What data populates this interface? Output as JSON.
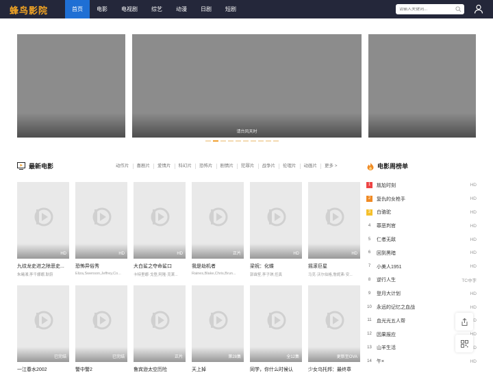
{
  "header": {
    "logo": "蜂鸟影院",
    "nav": [
      "首页",
      "电影",
      "电视剧",
      "综艺",
      "动漫",
      "日剧",
      "短剧"
    ],
    "search_placeholder": "请输入关键词..."
  },
  "banner": {
    "caption": "请台风天时"
  },
  "latest": {
    "title": "最新电影",
    "categories": [
      "动作片",
      "喜剧片",
      "爱情片",
      "科幻片",
      "恐怖片",
      "剧情片",
      "犯罪片",
      "战争片",
      "伦理片",
      "动画片",
      "更多 >"
    ]
  },
  "movies_row1": [
    {
      "title": "九纹龙史进之除恶史...",
      "sub": "朱曦湘,李千娜娜,耿蔚",
      "badge": "HD"
    },
    {
      "title": "恐怖异俗秀",
      "sub": "Eliza,Swenson,Jeffrey,Co...",
      "badge": "HD"
    },
    {
      "title": "大白鲨之夺命鲨口",
      "sub": "卡特里娜·戈登,阿隆·克莱...",
      "badge": "HD"
    },
    {
      "title": "我是劫机者",
      "sub": "Raines,Blake,Chris,Brun...",
      "badge": "正片"
    },
    {
      "title": "梁祝：化蝶",
      "sub": "郭霖笙,李子琪,任真",
      "badge": "HD"
    },
    {
      "title": "摇滚巨星",
      "sub": "马克·沃尔伯格,詹妮弗·安...",
      "badge": "HD"
    }
  ],
  "movies_row2": [
    {
      "title": "一江春水2002",
      "sub": "",
      "badge": "已完结"
    },
    {
      "title": "警中警2",
      "sub": "",
      "badge": "已完结"
    },
    {
      "title": "鲁宾逊太空历险",
      "sub": "",
      "badge": "正片"
    },
    {
      "title": "天上掉",
      "sub": "",
      "badge": "第28集"
    },
    {
      "title": "同学，你什么时候认",
      "sub": "",
      "badge": "全12集"
    },
    {
      "title": "少女乌托邦：最终章",
      "sub": "",
      "badge": "更新至OVA"
    }
  ],
  "ranking": {
    "title": "电影周榜单",
    "items": [
      {
        "n": "1",
        "name": "尴尬时刻",
        "tag": "HD"
      },
      {
        "n": "2",
        "name": "复仇的女枪手",
        "tag": "HD"
      },
      {
        "n": "3",
        "name": "白骆驼",
        "tag": "HD"
      },
      {
        "n": "4",
        "name": "罪恶判官",
        "tag": "HD"
      },
      {
        "n": "5",
        "name": "仁者无敌",
        "tag": "HD"
      },
      {
        "n": "6",
        "name": "回到黑暗",
        "tag": "HD"
      },
      {
        "n": "7",
        "name": "小美人1951",
        "tag": "HD"
      },
      {
        "n": "8",
        "name": "逆行人生",
        "tag": "TC中字"
      },
      {
        "n": "9",
        "name": "登月大计划",
        "tag": "HD"
      },
      {
        "n": "10",
        "name": "永远的记忆之血战",
        "tag": "HD"
      },
      {
        "n": "11",
        "name": "血光光五人帮",
        "tag": "HD"
      },
      {
        "n": "12",
        "name": "因果报应",
        "tag": "HD"
      },
      {
        "n": "13",
        "name": "山羊生活",
        "tag": "HD"
      },
      {
        "n": "14",
        "name": "午×",
        "tag": "HD"
      }
    ]
  },
  "colors": {
    "topbar": "#24273a",
    "accent": "#1f6fd4",
    "logo": "#f5a623"
  }
}
